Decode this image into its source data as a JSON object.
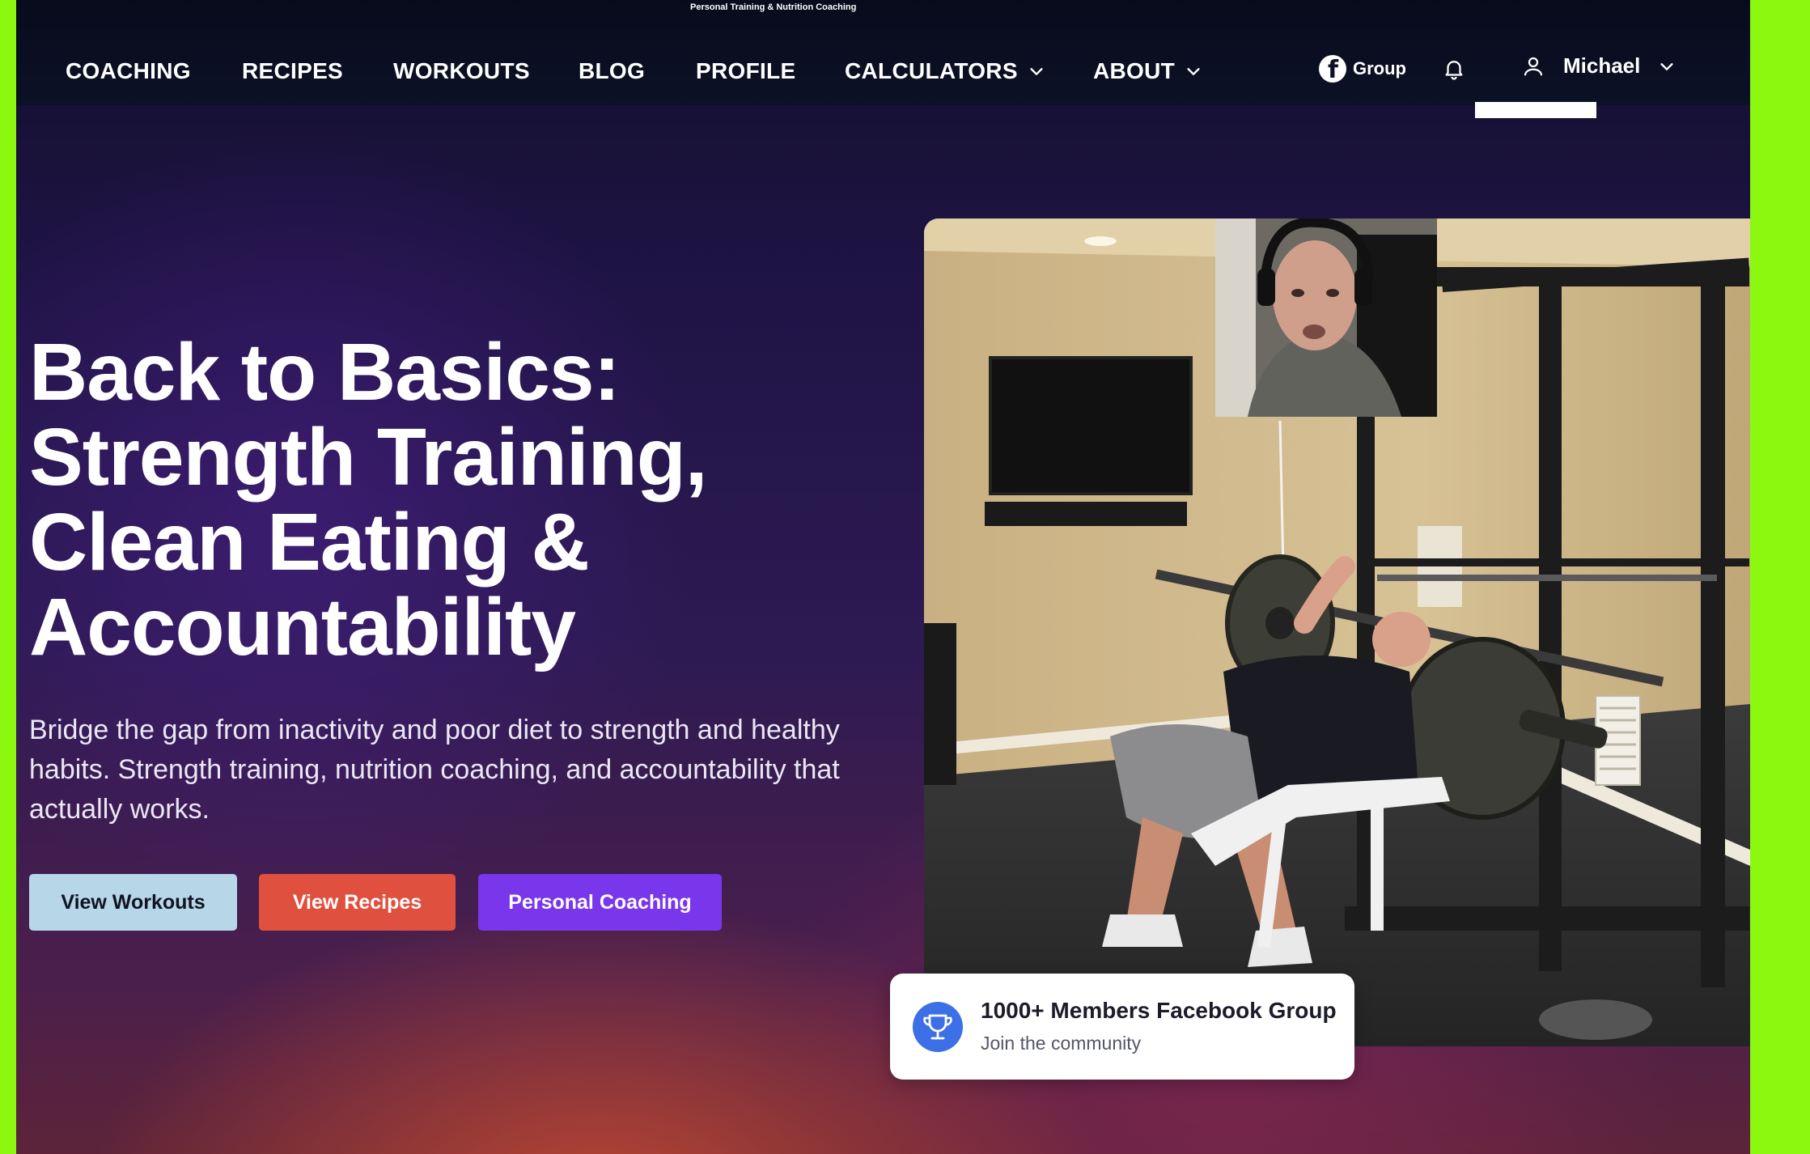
{
  "header": {
    "tagline": "Personal Training & Nutrition Coaching",
    "nav": [
      {
        "label": "COACHING"
      },
      {
        "label": "RECIPES"
      },
      {
        "label": "WORKOUTS"
      },
      {
        "label": "BLOG"
      },
      {
        "label": "PROFILE"
      },
      {
        "label": "CALCULATORS",
        "has_dropdown": true
      },
      {
        "label": "ABOUT",
        "has_dropdown": true
      }
    ],
    "group_label": "Group",
    "group_icon": "facebook-icon",
    "notifications_icon": "bell-icon",
    "user": {
      "name": "Michael",
      "icon": "user-icon"
    }
  },
  "hero": {
    "headline_lines": [
      "Back to Basics:",
      "Strength Training,",
      "Clean Eating &",
      "Accountability"
    ],
    "subtitle": "Bridge the gap from inactivity and poor diet to strength and healthy habits. Strength training, nutrition coaching, and accountability that actually works.",
    "buttons": {
      "workouts": "View Workouts",
      "recipes": "View Recipes",
      "coaching": "Personal Coaching"
    }
  },
  "badge": {
    "title": "1000+ Members Facebook Group",
    "subtitle": "Join the community",
    "icon": "trophy-icon"
  },
  "colors": {
    "frame": "#8cf70f",
    "nav_bg": "#0d1126",
    "btn_workouts": "#b7d6e8",
    "btn_recipes": "#e0503f",
    "btn_coaching": "#7a36eb",
    "badge_icon": "#3d6fe6"
  }
}
